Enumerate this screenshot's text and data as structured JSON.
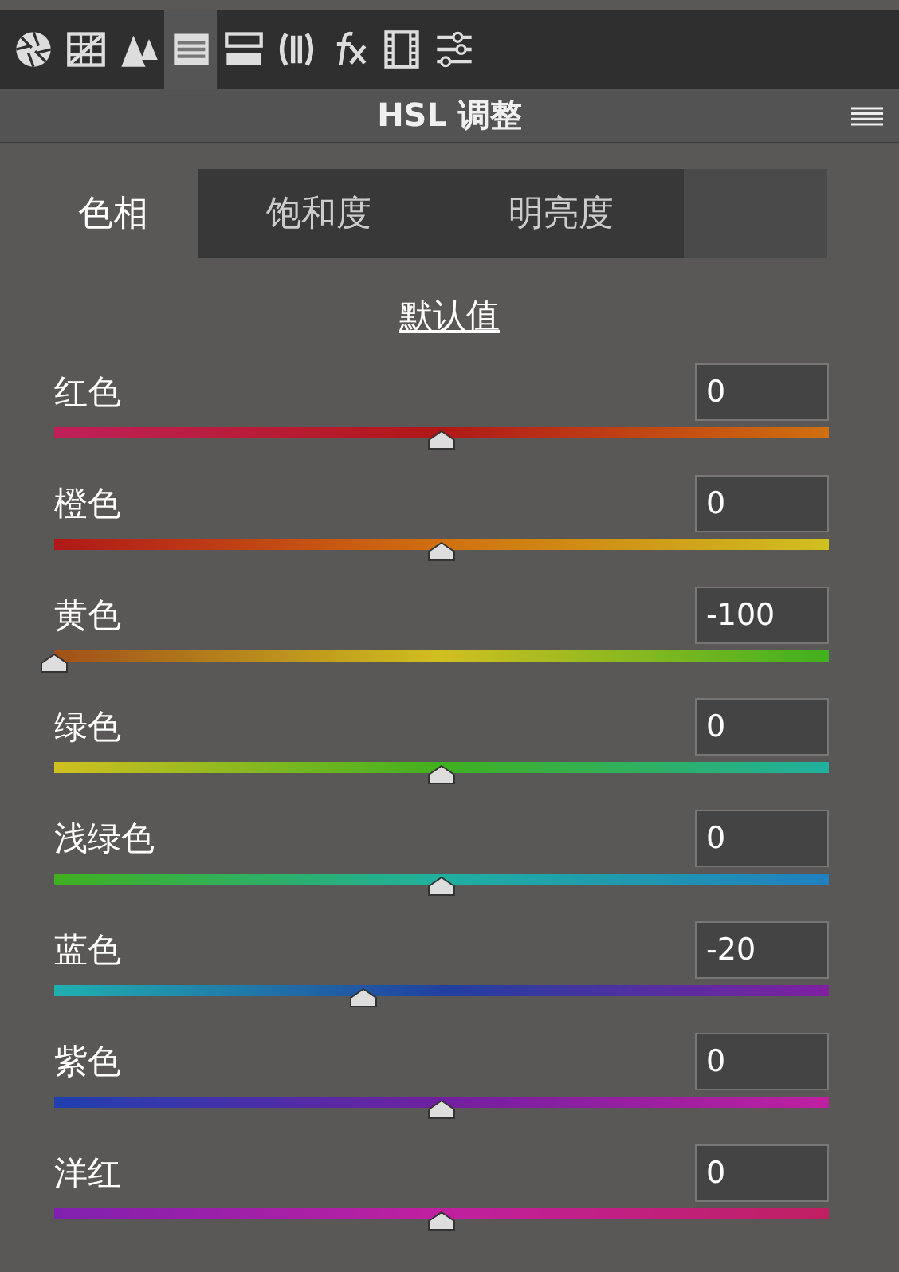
{
  "toolbar": {
    "tools": [
      {
        "selected": false
      },
      {
        "selected": false
      },
      {
        "selected": false
      },
      {
        "selected": true
      },
      {
        "selected": false
      },
      {
        "selected": false
      },
      {
        "selected": false
      },
      {
        "selected": false
      },
      {
        "selected": false
      }
    ]
  },
  "panel": {
    "title": "HSL 调整"
  },
  "tabs": [
    {
      "label": "色相",
      "selected": true
    },
    {
      "label": "饱和度",
      "selected": false
    },
    {
      "label": "明亮度",
      "selected": false
    }
  ],
  "default_link": "默认值",
  "sliders": [
    {
      "name": "红色",
      "value": "0",
      "level": 0.5
    },
    {
      "name": "橙色",
      "value": "0",
      "level": 0.5
    },
    {
      "name": "黄色",
      "value": "-100",
      "level": 0
    },
    {
      "name": "绿色",
      "value": "0",
      "level": 0.5
    },
    {
      "name": "浅绿色",
      "value": "0",
      "level": 0.5
    },
    {
      "name": "蓝色",
      "value": "-20",
      "level": 0.4
    },
    {
      "name": "紫色",
      "value": "0",
      "level": 0.5
    },
    {
      "name": "洋红",
      "value": "0",
      "level": 0.5
    }
  ]
}
